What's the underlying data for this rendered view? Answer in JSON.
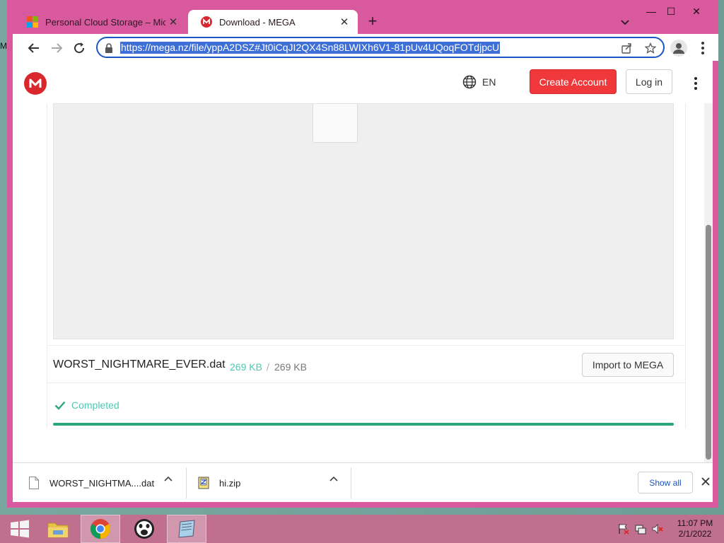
{
  "browser": {
    "tabs": [
      {
        "title": "Personal Cloud Storage – Micros",
        "favicon": "microsoft-icon",
        "active": false
      },
      {
        "title": "Download - MEGA",
        "favicon": "mega-icon",
        "active": true
      }
    ],
    "url": "https://mega.nz/file/yppA2DSZ#Jt0iCqJI2QX4Sn88LWIXh6V1-81pUv4UQoqFOTdjpcU"
  },
  "header": {
    "language": "EN",
    "create_account": "Create Account",
    "login": "Log in"
  },
  "download": {
    "file_name": "WORST_NIGHTMARE_EVER.dat",
    "downloaded": "269 KB",
    "separator": "/",
    "total": "269 KB",
    "import_button": "Import to MEGA",
    "status": "Completed",
    "progress": 1.0
  },
  "shelf": {
    "items": [
      {
        "name": "WORST_NIGHTMA....dat",
        "icon": "file-icon"
      },
      {
        "name": "hi.zip",
        "icon": "zip-icon"
      }
    ],
    "show_all": "Show all"
  },
  "taskbar": {
    "time": "11:07 PM",
    "date": "2/1/2022"
  },
  "colors": {
    "window_frame": "#d9599f",
    "mega_red": "#d9272e",
    "accent_green": "#4fc7b1",
    "progress_green": "#2ba87c",
    "link_blue": "#1a56c4"
  }
}
